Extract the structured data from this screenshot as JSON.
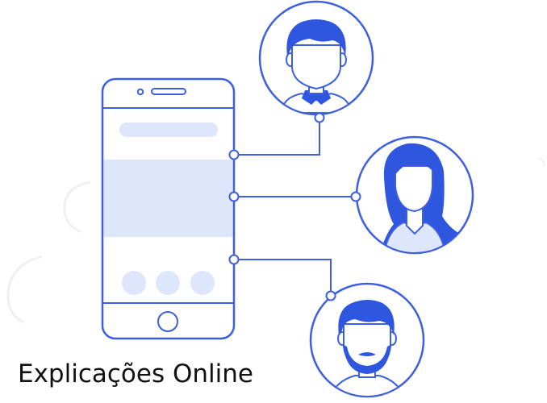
{
  "caption": {
    "text": "Explicações Online"
  },
  "colors": {
    "stroke": "#3d5fe0",
    "fill_light": "#dde6fb",
    "hair": "#2f56de",
    "face": "#ffffff",
    "text": "#111111",
    "decor": "#f1f1f1"
  },
  "icons": {
    "phone": "smartphone-icon",
    "person_top": "man-avatar-icon",
    "person_middle": "woman-avatar-icon",
    "person_bottom": "bearded-man-avatar-icon"
  }
}
